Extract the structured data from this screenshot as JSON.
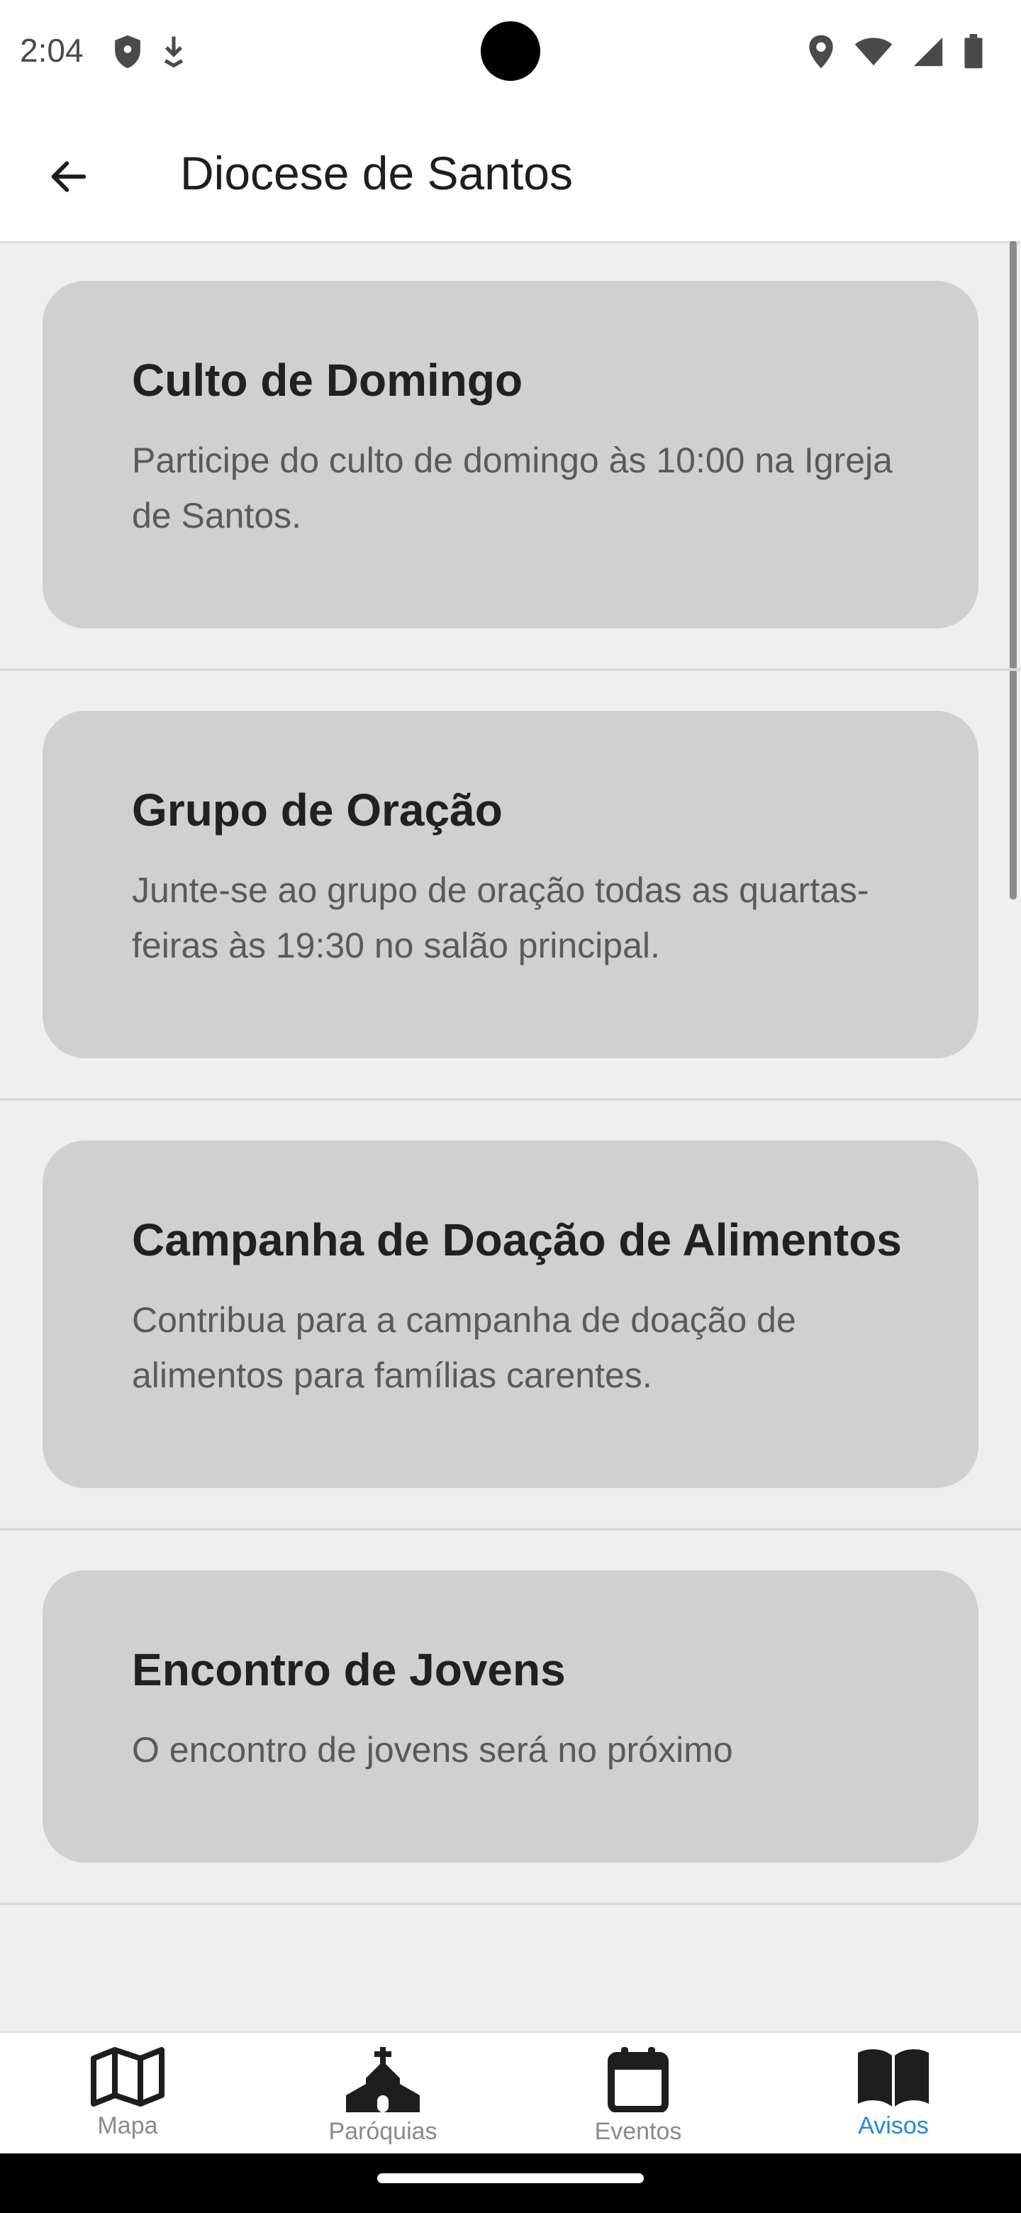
{
  "status_bar": {
    "time": "2:04",
    "left_icons": [
      "shield-icon",
      "download-icon"
    ],
    "right_icons": [
      "location-icon",
      "wifi-icon",
      "signal-icon",
      "battery-icon"
    ]
  },
  "app_bar": {
    "title": "Diocese de Santos",
    "back_icon": "arrow-back-icon"
  },
  "notices": [
    {
      "title": "Culto de Domingo",
      "description": "Participe do culto de domingo às 10:00 na Igreja de Santos."
    },
    {
      "title": "Grupo de Oração",
      "description": "Junte-se ao grupo de oração todas as quartas-feiras às 19:30 no salão principal."
    },
    {
      "title": "Campanha de Doação de Alimentos",
      "description": "Contribua para a campanha de doação de alimentos para famílias carentes."
    },
    {
      "title": "Encontro de Jovens",
      "description": "O encontro de jovens será no próximo"
    }
  ],
  "bottom_nav": {
    "items": [
      {
        "label": "Mapa",
        "icon": "map-icon",
        "active": false
      },
      {
        "label": "Paróquias",
        "icon": "church-icon",
        "active": false
      },
      {
        "label": "Eventos",
        "icon": "calendar-icon",
        "active": false
      },
      {
        "label": "Avisos",
        "icon": "book-icon",
        "active": true
      }
    ]
  },
  "colors": {
    "accent": "#1e88e5",
    "card_background": "#d0d0d0",
    "page_background": "#efefef"
  }
}
